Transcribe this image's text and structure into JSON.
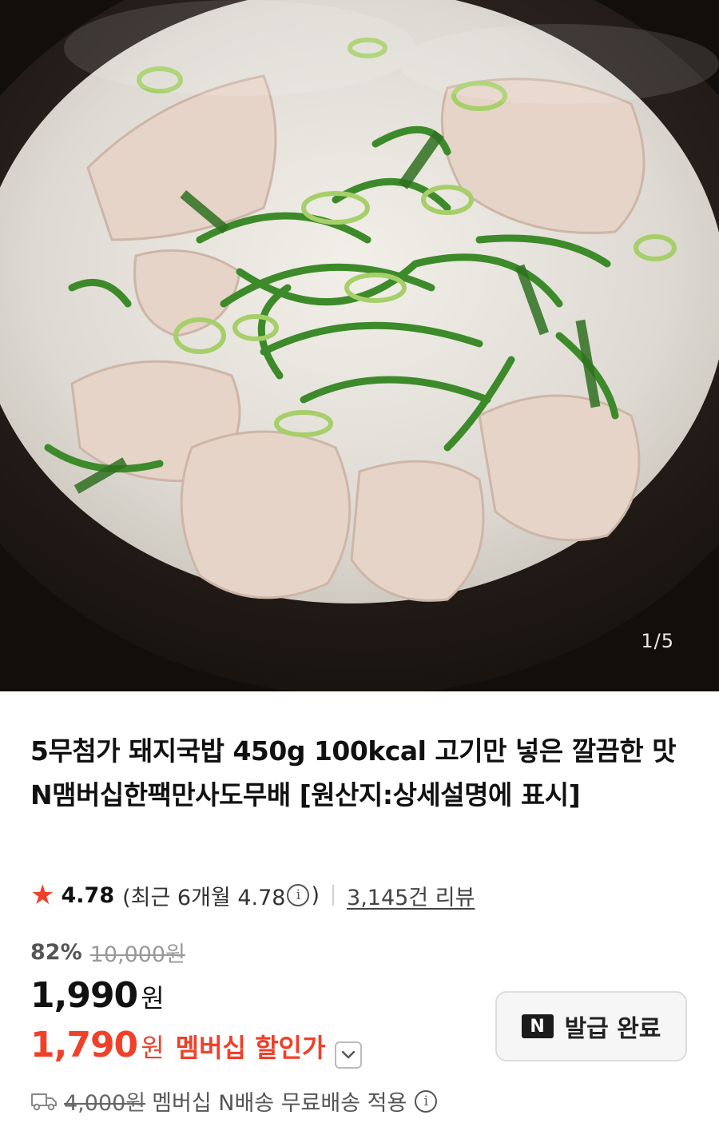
{
  "image": {
    "pager": "1/5",
    "description_icon": "gukbap-photo"
  },
  "product": {
    "title": "5무첨가 돼지국밥 450g 100kcal 고기만 넣은 깔끔한 맛 N맴버십한팩만사도무배 [원산지:상세설명에 표시]",
    "rating": {
      "score": "4.78",
      "recent_label": "(최근 6개월 4.78",
      "recent_close": ")",
      "review_count": "3,145건 리뷰"
    },
    "discount": {
      "rate": "82%",
      "original": "10,000원"
    },
    "price": {
      "value": "1,990",
      "unit": "원"
    },
    "member_price": {
      "value": "1,790",
      "unit": "원",
      "label": "멤버십 할인가"
    },
    "coupon": {
      "logo": "N",
      "label": "발급 완료"
    },
    "shipping": {
      "original": "4,000원",
      "text": "멤버십 N배송 무료배송 적용"
    }
  },
  "colors": {
    "accent_red": "#f0402a",
    "star": "#f0402a"
  }
}
